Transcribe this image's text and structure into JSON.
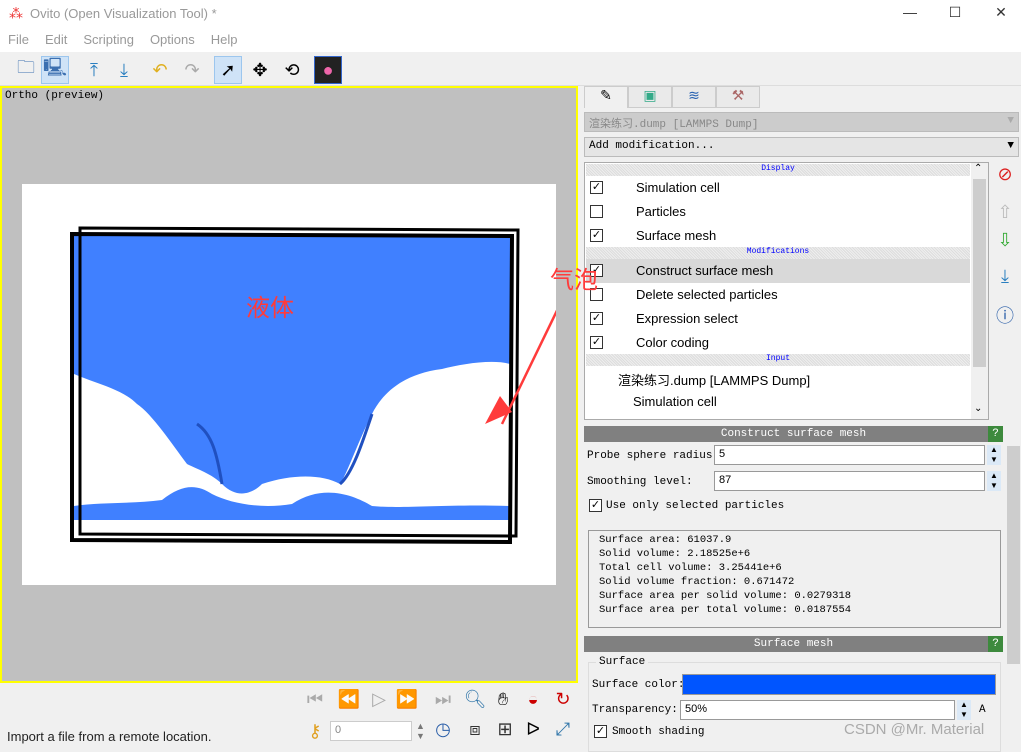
{
  "window": {
    "title": "Ovito (Open Visualization Tool) *",
    "minimize": "—",
    "maximize": "☐",
    "close": "✕"
  },
  "menu": [
    "File",
    "Edit",
    "Scripting",
    "Options",
    "Help"
  ],
  "toolbar": {
    "icons": [
      "open-file-icon",
      "load-remote-icon",
      "import-icon",
      "export-icon",
      "undo-icon",
      "redo-icon",
      "select-mode-icon",
      "move-icon",
      "rotate-icon",
      "render-icon"
    ]
  },
  "viewport": {
    "label": "Ortho (preview)",
    "annotations": {
      "liquid": "液体",
      "bubble": "气泡"
    },
    "surface_color": "#4080ff",
    "annotation_color": "#ff3b3b"
  },
  "status": {
    "text": "Import a file from a remote location.",
    "frame": "0"
  },
  "panel": {
    "source_dropdown": "渲染练习.dump [LAMMPS Dump]",
    "add_modification": "Add modification...",
    "sections": {
      "display": "Display",
      "modifications": "Modifications",
      "input": "Input"
    },
    "display_items": [
      {
        "label": "Simulation cell",
        "checked": true
      },
      {
        "label": "Particles",
        "checked": false
      },
      {
        "label": "Surface mesh",
        "checked": true
      }
    ],
    "modification_items": [
      {
        "label": "Construct surface mesh",
        "checked": true,
        "selected": true
      },
      {
        "label": "Delete selected particles",
        "checked": false
      },
      {
        "label": "Expression select",
        "checked": true
      },
      {
        "label": "Color coding",
        "checked": true
      }
    ],
    "input_items": [
      "渲染练习.dump [LAMMPS Dump]",
      "Simulation cell"
    ]
  },
  "construct": {
    "title": "Construct surface mesh",
    "help": "?",
    "probe_label": "Probe sphere radius:",
    "probe_value": "5",
    "smooth_label": "Smoothing level:",
    "smooth_value": "87",
    "use_selected_label": "Use only selected particles",
    "use_selected": true,
    "stats": [
      "Surface area: 61037.9",
      "Solid volume: 2.18525e+6",
      "Total cell volume: 3.25441e+6",
      "Solid volume fraction: 0.671472",
      "Surface area per solid volume: 0.0279318",
      "Surface area per total volume: 0.0187554"
    ]
  },
  "surfacemesh": {
    "title": "Surface mesh",
    "help": "?",
    "group": "Surface",
    "color_label": "Surface color:",
    "color": "#0055ff",
    "transparency_label": "Transparency:",
    "transparency_value": "50%",
    "anim_label": "A",
    "smooth_label": "Smooth shading",
    "smooth": true
  },
  "watermark": "CSDN @Mr. Material"
}
